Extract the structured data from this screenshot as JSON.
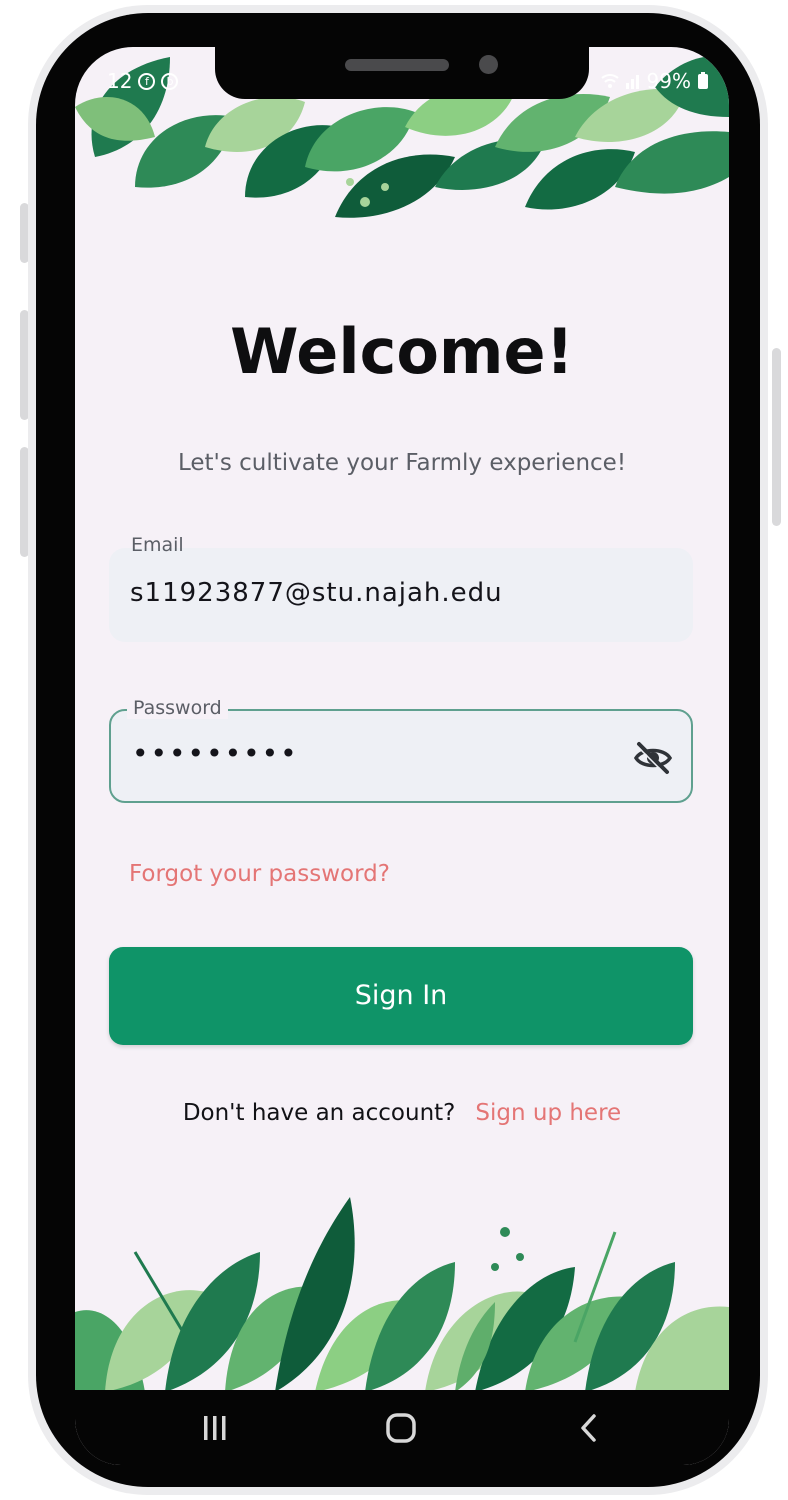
{
  "status_bar": {
    "time": "12",
    "battery": "99%"
  },
  "login": {
    "title": "Welcome!",
    "subtitle": "Let's cultivate your Farmly experience!",
    "email_label": "Email",
    "email_value": "s11923877@stu.najah.edu",
    "password_label": "Password",
    "password_value": "•••••••••",
    "forgot_link": "Forgot your password?",
    "signin_label": "Sign In",
    "signup_question": "Don't have an account?",
    "signup_link": "Sign up here"
  },
  "icons": [
    "facebook-icon",
    "app-icon",
    "wifi-icon",
    "signal-icon",
    "battery-icon",
    "eye-off-icon",
    "recents-icon",
    "home-icon",
    "back-icon"
  ],
  "colors": {
    "background": "#f6f1f7",
    "primary_button": "#0f9468",
    "link": "#e47575",
    "field_fill": "#eef0f5",
    "focus_border": "#5fa08f"
  }
}
